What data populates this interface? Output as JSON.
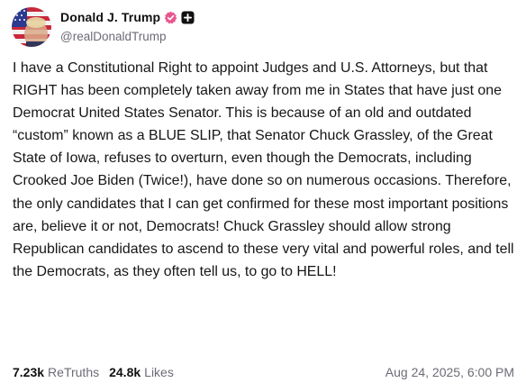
{
  "author": {
    "display_name": "Donald J. Trump",
    "handle": "@realDonaldTrump",
    "avatar_icon": "flag-portrait-avatar",
    "verified_icon": "verified-badge-icon",
    "extra_badge_icon": "plus-badge-icon"
  },
  "post": {
    "text": "I have a Constitutional Right to appoint Judges and U.S. Attorneys, but that RIGHT has been completely taken away from me in States that have just one Democrat United States Senator. This is because of an old and outdated “custom” known as a BLUE SLIP, that Senator Chuck Grassley, of the Great State of Iowa, refuses to overturn, even though the Democrats, including Crooked Joe Biden (Twice!), have done so on numerous occasions. Therefore, the only candidates that I can get confirmed for these most important positions are, believe it or not, Democrats! Chuck Grassley should allow strong Republican candidates to ascend to these very vital and powerful roles, and tell the Democrats, as they often tell us, to go to HELL!"
  },
  "stats": {
    "retruths_count": "7.23k",
    "retruths_label": "ReTruths",
    "likes_count": "24.8k",
    "likes_label": "Likes"
  },
  "timestamp": "Aug 24, 2025, 6:00 PM",
  "colors": {
    "verified_badge": "#e8578f",
    "plus_badge": "#111111",
    "muted_text": "#6b6b76"
  }
}
